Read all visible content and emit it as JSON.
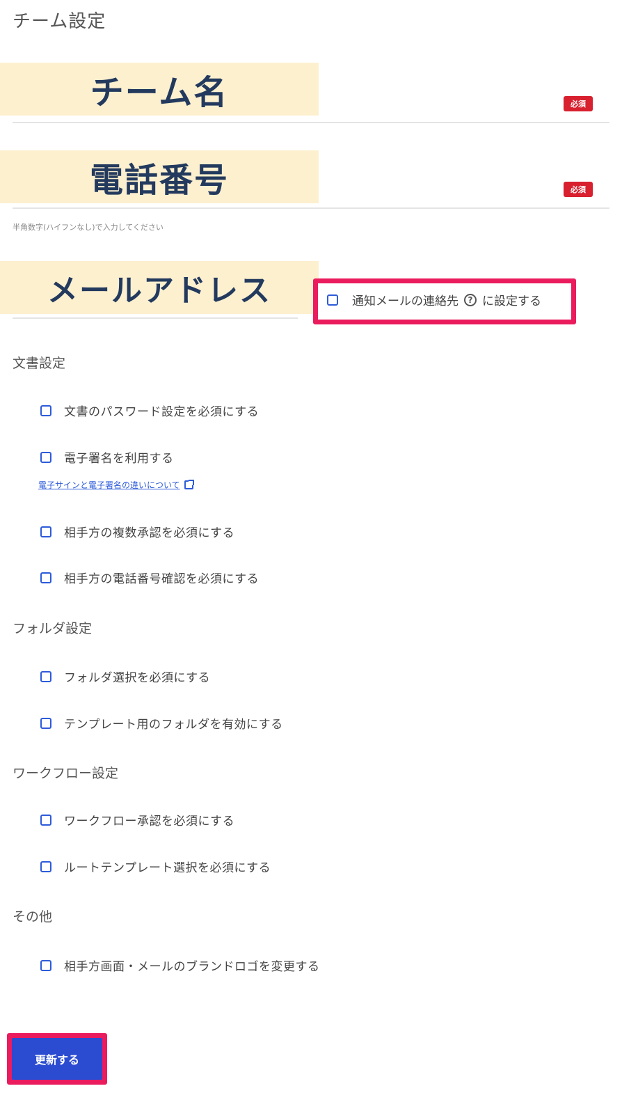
{
  "page": {
    "title": "チーム設定"
  },
  "fields": {
    "team_name": {
      "label": "チーム名",
      "required_badge": "必須"
    },
    "phone": {
      "label": "電話番号",
      "required_badge": "必須",
      "hint": "半角数字(ハイフンなし)で入力してください"
    },
    "email": {
      "label": "メールアドレス",
      "notify_checkbox_label_before": "通知メールの連絡先",
      "notify_checkbox_label_after": "に設定する",
      "notify_checked": false
    }
  },
  "sections": {
    "document": {
      "title": "文書設定",
      "options": [
        {
          "label": "文書のパスワード設定を必須にする",
          "checked": false
        },
        {
          "label": "電子署名を利用する",
          "checked": false
        },
        {
          "label": "相手方の複数承認を必須にする",
          "checked": false
        },
        {
          "label": "相手方の電話番号確認を必須にする",
          "checked": false
        }
      ],
      "link_text": "電子サインと電子署名の違いについて"
    },
    "folder": {
      "title": "フォルダ設定",
      "options": [
        {
          "label": "フォルダ選択を必須にする",
          "checked": false
        },
        {
          "label": "テンプレート用のフォルダを有効にする",
          "checked": false
        }
      ]
    },
    "workflow": {
      "title": "ワークフロー設定",
      "options": [
        {
          "label": "ワークフロー承認を必須にする",
          "checked": false
        },
        {
          "label": "ルートテンプレート選択を必須にする",
          "checked": false
        }
      ]
    },
    "other": {
      "title": "その他",
      "options": [
        {
          "label": "相手方画面・メールのブランドロゴを変更する",
          "checked": false
        }
      ]
    }
  },
  "actions": {
    "update_label": "更新する"
  },
  "colors": {
    "highlight": "#ea1c5e",
    "accent": "#2b4bd1",
    "banner_bg": "#fdf0cf",
    "banner_text": "#233a5e",
    "required": "#d8202f"
  },
  "icons": {
    "help": "question-circle-icon",
    "external": "external-link-icon"
  }
}
